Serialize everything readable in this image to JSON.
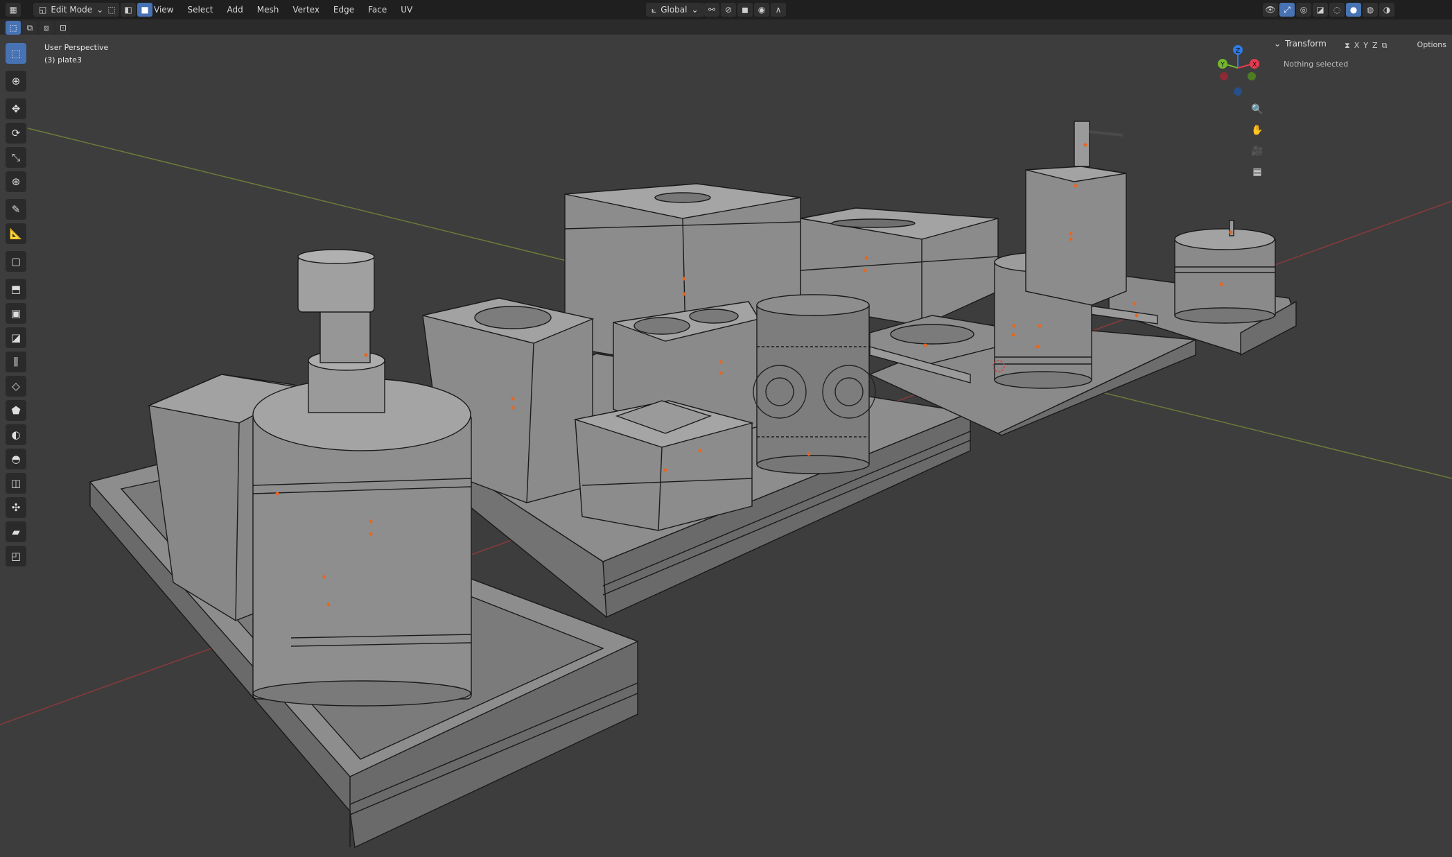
{
  "header": {
    "mode_label": "Edit Mode",
    "menus": [
      "View",
      "Select",
      "Add",
      "Mesh",
      "Vertex",
      "Edge",
      "Face",
      "UV"
    ],
    "orientation_label": "Global",
    "options_label": "Options",
    "axes": [
      "X",
      "Y",
      "Z"
    ]
  },
  "viewport": {
    "perspective_label": "User Perspective",
    "object_label": "(3) plate3"
  },
  "sidebar": {
    "panel_title": "Transform",
    "status_text": "Nothing selected"
  },
  "gizmo": {
    "axes": [
      "Z",
      "Y",
      "X"
    ],
    "colors": {
      "x": "#e53b4e",
      "y": "#74b72f",
      "z": "#2f7be5"
    }
  },
  "tools": [
    {
      "name": "select-box-icon",
      "glyph": "⬚"
    },
    {
      "name": "cursor-icon",
      "glyph": "⊕"
    },
    {
      "name": "move-icon",
      "glyph": "✥"
    },
    {
      "name": "rotate-icon",
      "glyph": "⟳"
    },
    {
      "name": "scale-icon",
      "glyph": "⤡"
    },
    {
      "name": "transform-icon",
      "glyph": "⊛"
    },
    {
      "name": "annotate-icon",
      "glyph": "✎"
    },
    {
      "name": "measure-icon",
      "glyph": "📐"
    },
    {
      "name": "add-cube-icon",
      "glyph": "▢"
    },
    {
      "name": "extrude-icon",
      "glyph": "⬒"
    },
    {
      "name": "inset-icon",
      "glyph": "▣"
    },
    {
      "name": "bevel-icon",
      "glyph": "◪"
    },
    {
      "name": "loop-cut-icon",
      "glyph": "⫼"
    },
    {
      "name": "knife-icon",
      "glyph": "◇"
    },
    {
      "name": "poly-build-icon",
      "glyph": "⬟"
    },
    {
      "name": "spin-icon",
      "glyph": "◐"
    },
    {
      "name": "smooth-icon",
      "glyph": "◓"
    },
    {
      "name": "edge-slide-icon",
      "glyph": "◫"
    },
    {
      "name": "shrink-fatten-icon",
      "glyph": "✣"
    },
    {
      "name": "shear-icon",
      "glyph": "▰"
    },
    {
      "name": "rip-icon",
      "glyph": "◰"
    }
  ]
}
